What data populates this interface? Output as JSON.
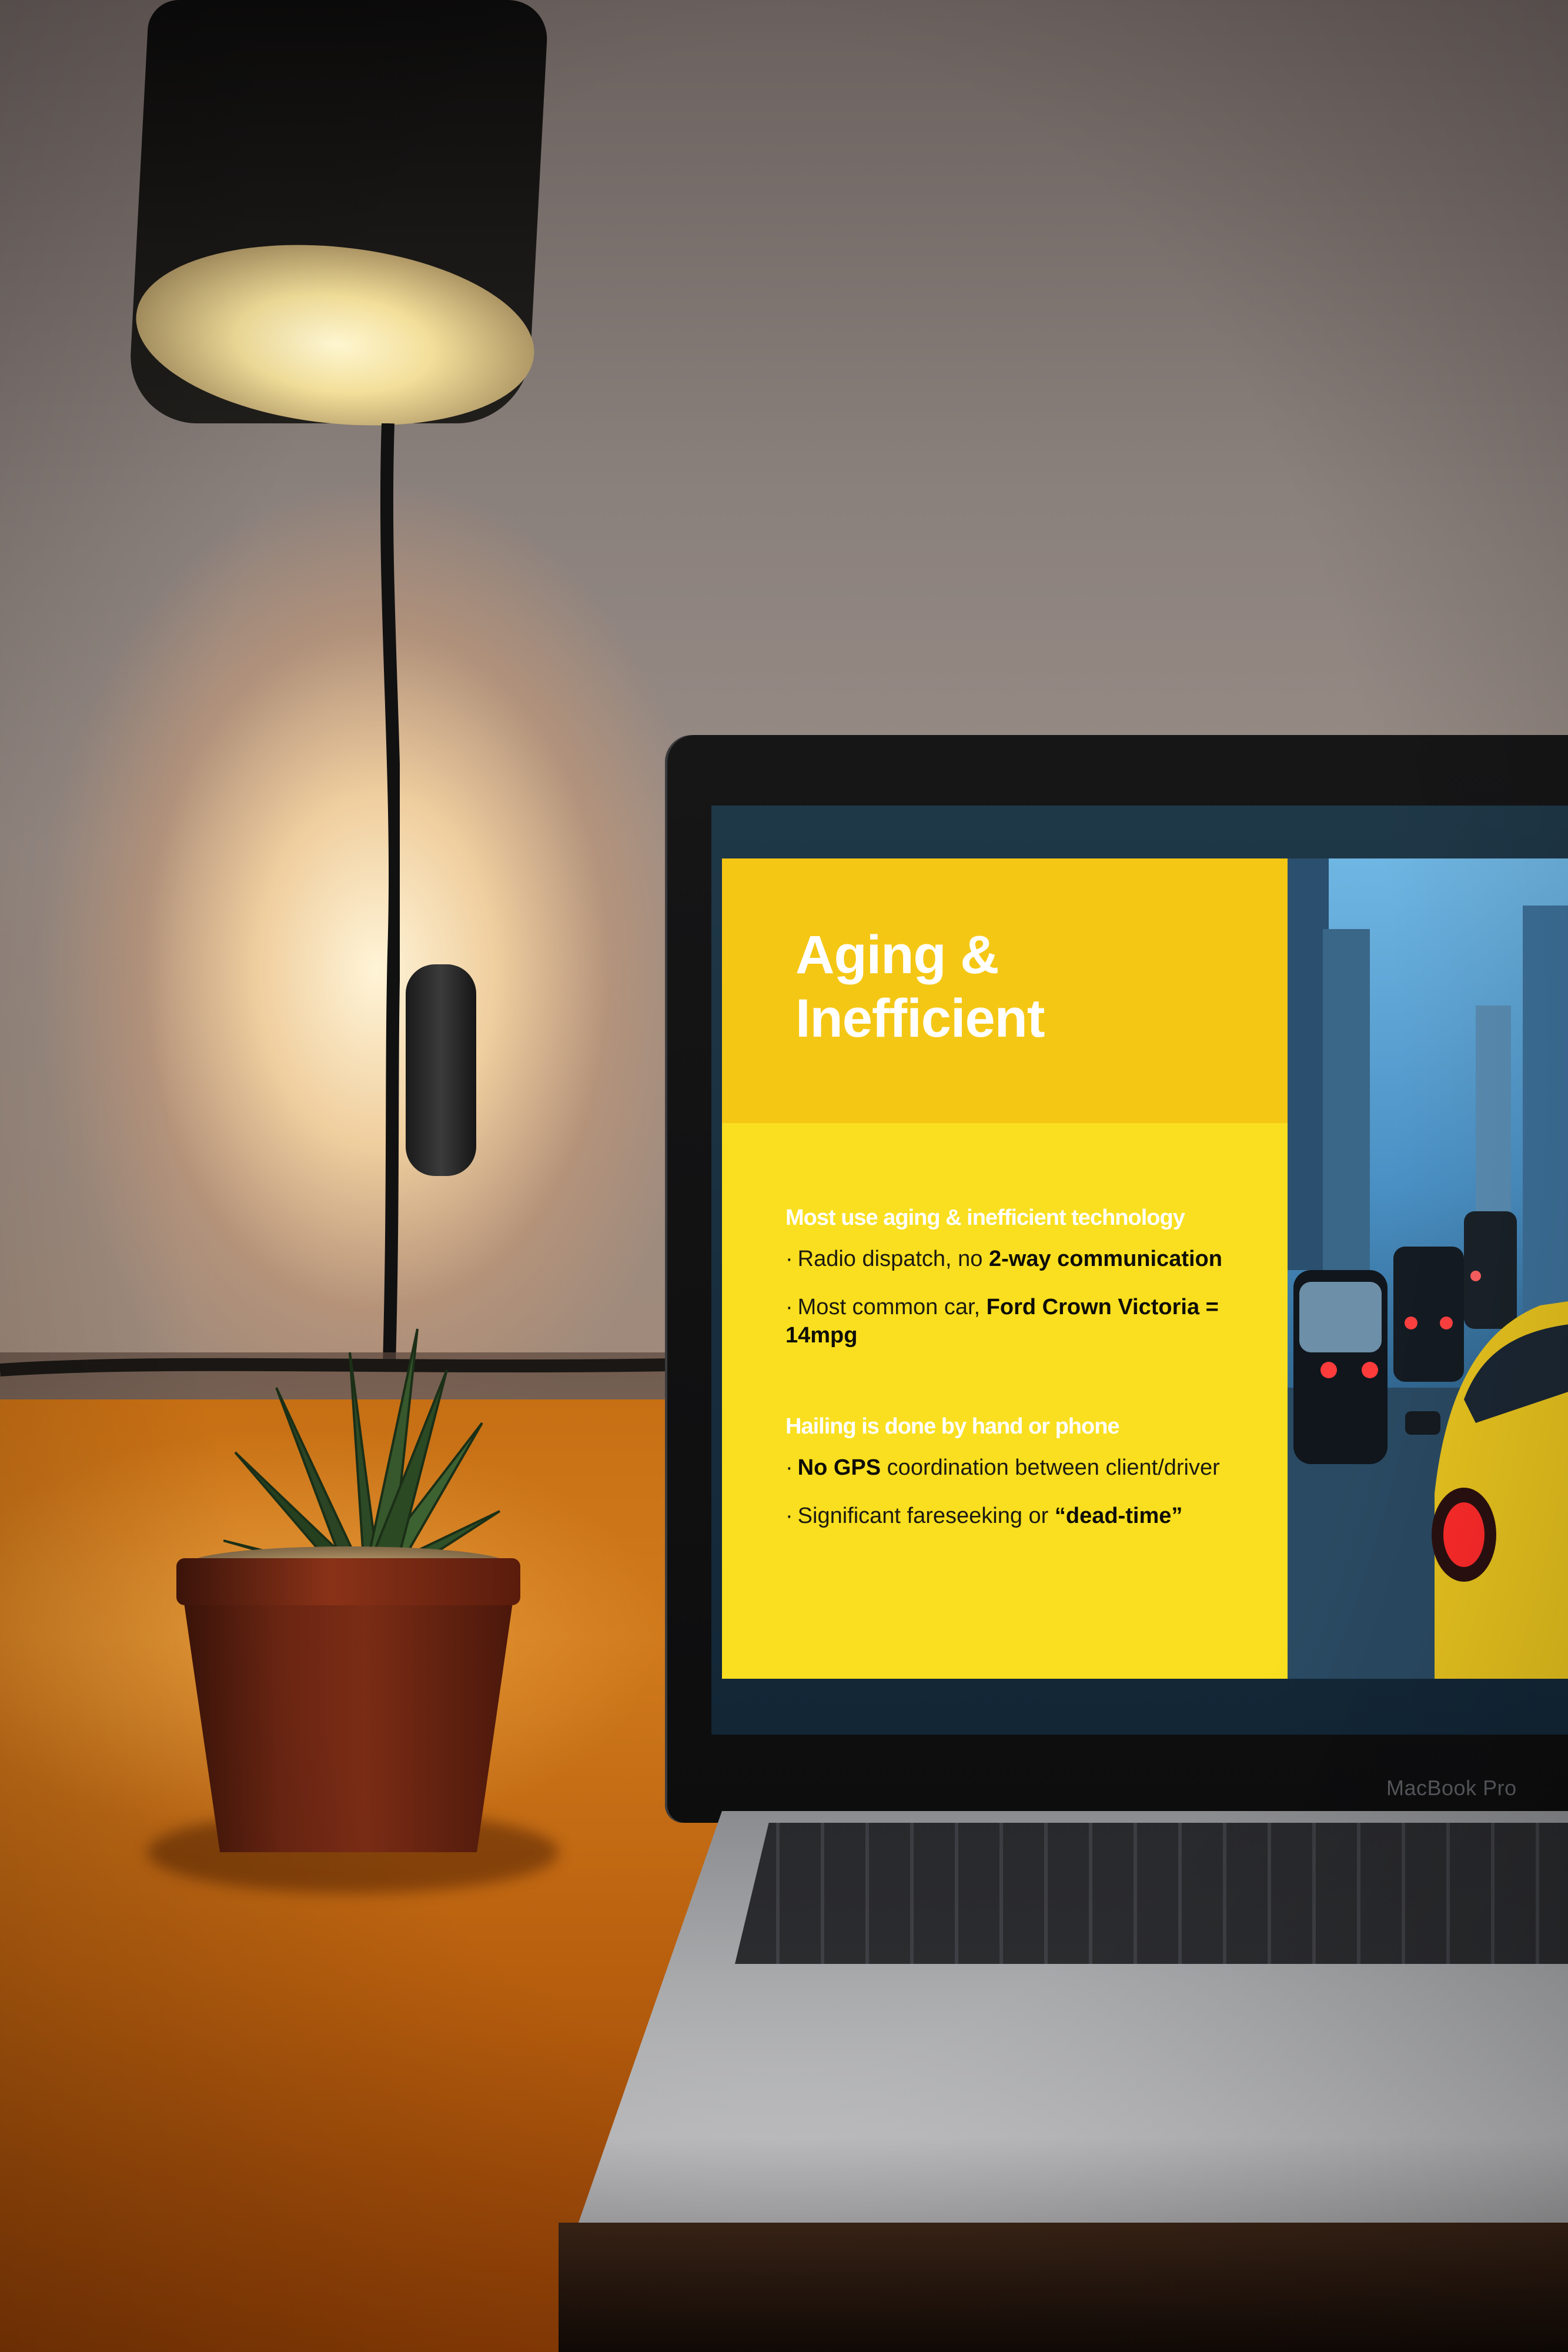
{
  "slide": {
    "title_line1": "Aging &",
    "title_line2": "Inefficient",
    "section1_heading": "Most use aging & inefficient technology",
    "bullets1": [
      {
        "normal": "Radio dispatch, no ",
        "bold": "2-way communication",
        "after": ""
      },
      {
        "normal": "Most common car, ",
        "bold": "Ford Crown Victoria = 14mpg",
        "after": ""
      }
    ],
    "section2_heading": "Hailing is done by hand or phone",
    "bullets2": [
      {
        "normal": "",
        "bold": "No GPS",
        "after": " coordination between client/driver"
      },
      {
        "normal": "Significant fareseeking or ",
        "bold": "“dead-time”",
        "after": ""
      }
    ],
    "bullet_glyph": "·"
  },
  "laptop": {
    "brand": "MacBook Pro"
  },
  "colors": {
    "slide_yellow": "#f9df1f",
    "slide_title_band": "#f5c715",
    "table_orange": "#c76f14",
    "pot_terracotta": "#6a2512"
  },
  "icons": [
    "lamp-icon",
    "succulent-plant-icon"
  ]
}
